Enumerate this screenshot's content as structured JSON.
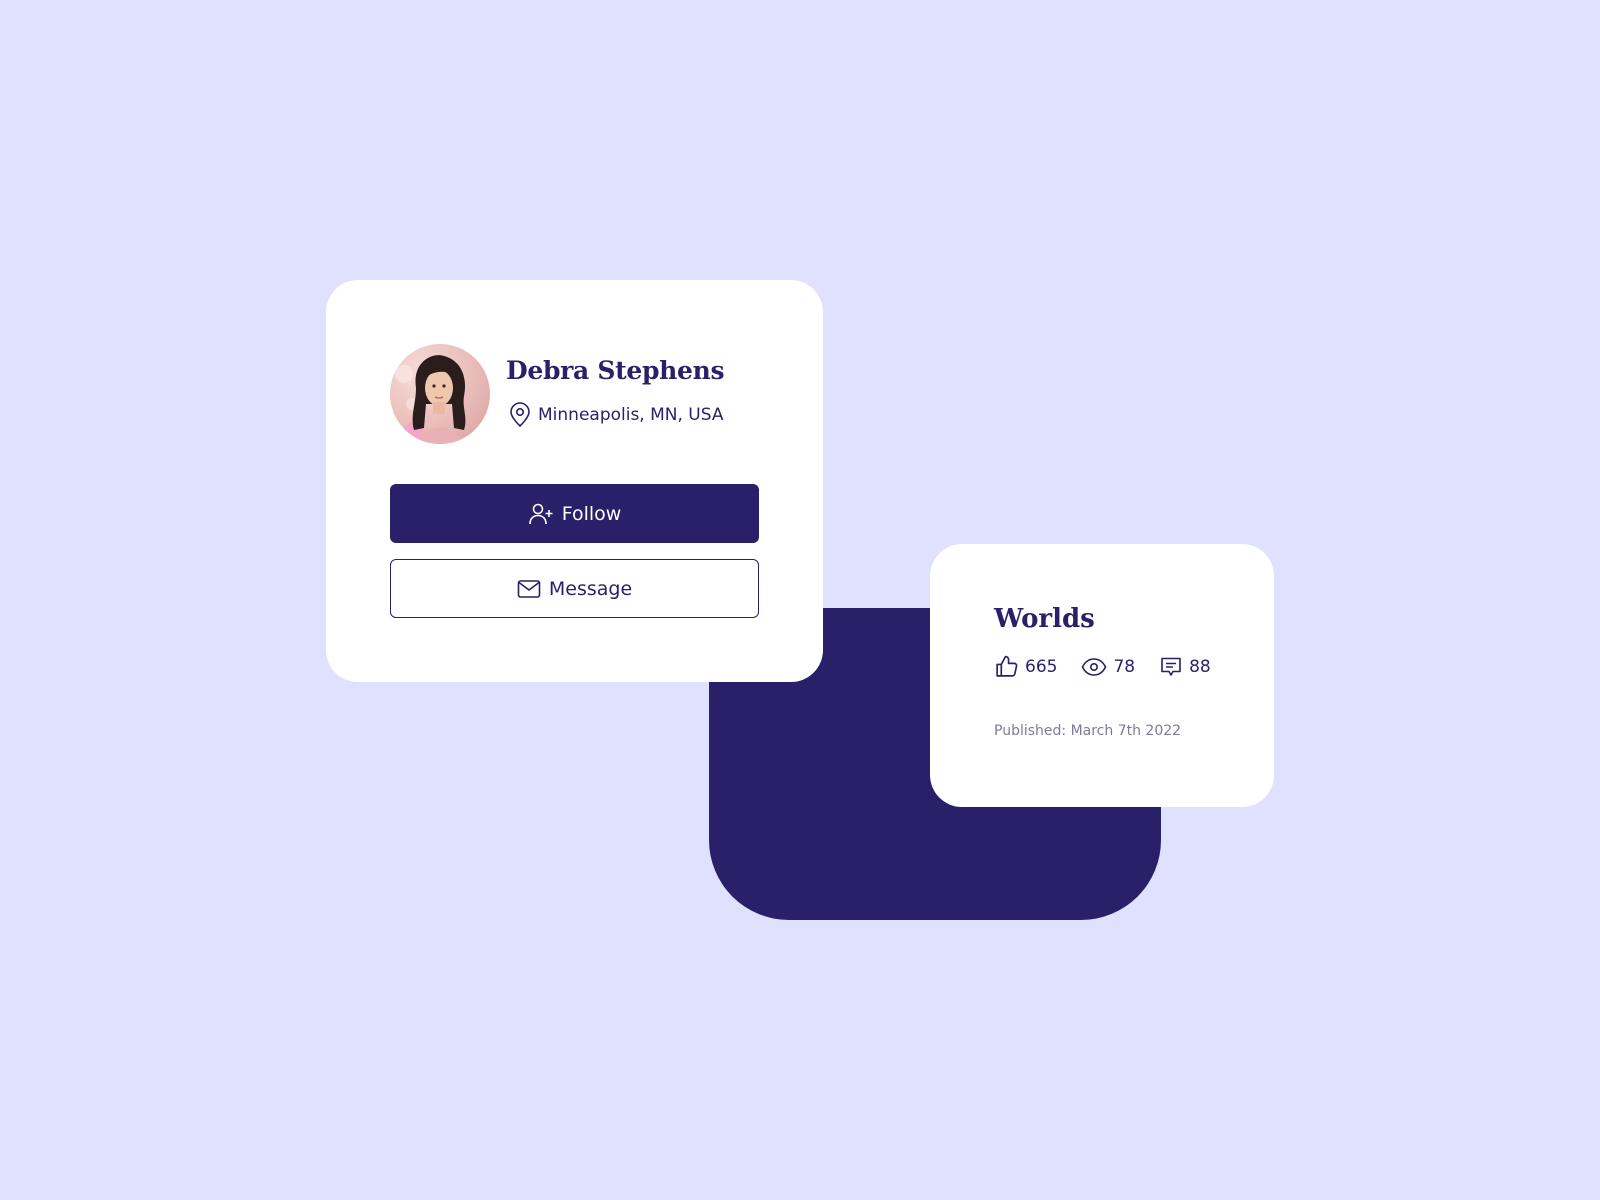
{
  "colors": {
    "background": "#dfe1fe",
    "brand": "#2a1f69",
    "card": "#ffffff",
    "muted": "#7e7a9c"
  },
  "profile": {
    "name": "Debra Stephens",
    "location": "Minneapolis, MN, USA",
    "location_icon": "map-pin-icon",
    "follow_label": "Follow",
    "follow_icon": "user-plus-icon",
    "message_label": "Message",
    "message_icon": "mail-icon"
  },
  "post": {
    "title": "Worlds",
    "likes": "665",
    "likes_icon": "thumbs-up-icon",
    "views": "78",
    "views_icon": "eye-icon",
    "comments": "88",
    "comments_icon": "comment-icon",
    "published": "Published: March 7th 2022"
  }
}
